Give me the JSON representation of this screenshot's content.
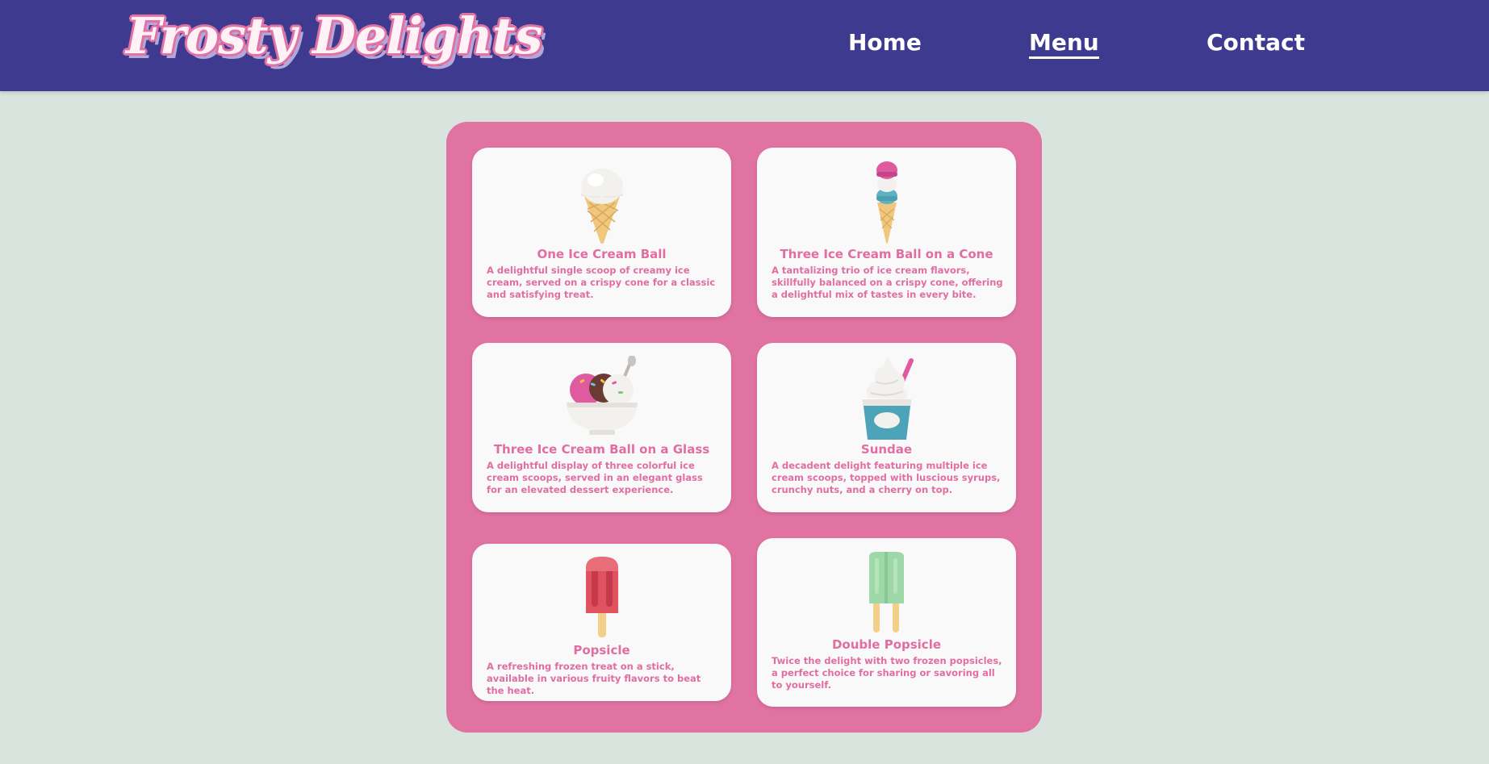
{
  "header": {
    "logo": "Frosty Delights",
    "nav": [
      {
        "label": "Home",
        "active": false
      },
      {
        "label": "Menu",
        "active": true
      },
      {
        "label": "Contact",
        "active": false
      }
    ]
  },
  "colors": {
    "header_bg": "#3d3a8f",
    "page_bg": "#dae4df",
    "panel_bg": "#e173a3",
    "card_bg": "#f9f9f9",
    "accent_text": "#e06ea1"
  },
  "menu": {
    "items": [
      {
        "title": "One Ice Cream Ball",
        "description": "A delightful single scoop of creamy ice cream, served on a crispy cone for a classic and satisfying treat.",
        "icon": "single-scoop-cone-icon"
      },
      {
        "title": "Three Ice Cream Ball on a Cone",
        "description": "A tantalizing trio of ice cream flavors, skillfully balanced on a crispy cone, offering a delightful mix of tastes in every bite.",
        "icon": "triple-scoop-cone-icon"
      },
      {
        "title": "Three Ice Cream Ball on a Glass",
        "description": "A delightful display of three colorful ice cream scoops, served in an elegant glass for an elevated dessert experience.",
        "icon": "ice-cream-bowl-icon"
      },
      {
        "title": "Sundae",
        "description": "A decadent delight featuring multiple ice cream scoops, topped with luscious syrups, crunchy nuts, and a cherry on top.",
        "icon": "sundae-cup-icon"
      },
      {
        "title": "Popsicle",
        "description": "A refreshing frozen treat on a stick, available in various fruity flavors to beat the heat.",
        "icon": "popsicle-icon"
      },
      {
        "title": "Double Popsicle",
        "description": "Twice the delight with two frozen popsicles, a perfect choice for sharing or savoring all to yourself.",
        "icon": "double-popsicle-icon"
      }
    ]
  }
}
